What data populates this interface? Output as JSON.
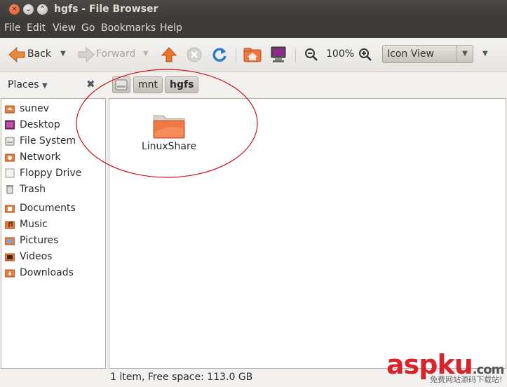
{
  "window": {
    "title": "hgfs - File Browser"
  },
  "menubar": [
    "File",
    "Edit",
    "View",
    "Go",
    "Bookmarks",
    "Help"
  ],
  "toolbar": {
    "back_label": "Back",
    "forward_label": "Forward",
    "zoom_level": "100%",
    "view_mode": "Icon View"
  },
  "places": {
    "header": "Places",
    "items": [
      "sunev",
      "Desktop",
      "File System",
      "Network",
      "Floppy Drive",
      "Trash",
      "Documents",
      "Music",
      "Pictures",
      "Videos",
      "Downloads"
    ]
  },
  "breadcrumb": [
    "mnt",
    "hgfs"
  ],
  "content": {
    "items": [
      {
        "name": "LinuxShare",
        "icon": "folder-icon"
      }
    ]
  },
  "status": {
    "text": "1 item, Free space: 113.0 GB"
  },
  "watermark": {
    "brand": "aspku",
    "suffix": ".com",
    "tagline": "免费网站源码下载站!"
  },
  "colors": {
    "titlebar": "#3c3b37",
    "accent": "#e05a1c",
    "folder": "#f07746"
  }
}
